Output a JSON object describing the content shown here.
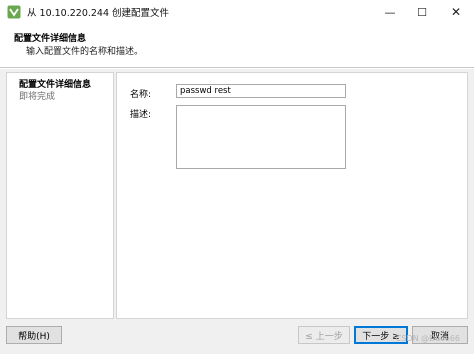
{
  "window": {
    "title": "从 10.10.220.244 创建配置文件",
    "minimize_glyph": "—",
    "maximize_glyph": "☐",
    "close_glyph": "✕",
    "icon": "vsphere-logo-icon"
  },
  "header": {
    "title": "配置文件详细信息",
    "subtitle": "输入配置文件的名称和描述。"
  },
  "steps": [
    {
      "label": "配置文件详细信息",
      "state": "current"
    },
    {
      "label": "即将完成",
      "state": "pending"
    }
  ],
  "form": {
    "name_label": "名称:",
    "name_value": "passwd rest",
    "desc_label": "描述:",
    "desc_value": ""
  },
  "buttons": {
    "help": "帮助(H)",
    "back": "≤ 上一步",
    "next": "下一步 ≥",
    "cancel": "取消"
  },
  "watermark": "CSDN @Dave66",
  "colors": {
    "accent": "#0078d7",
    "background": "#f0f0f0",
    "disabled_text": "#a0a0a0"
  }
}
